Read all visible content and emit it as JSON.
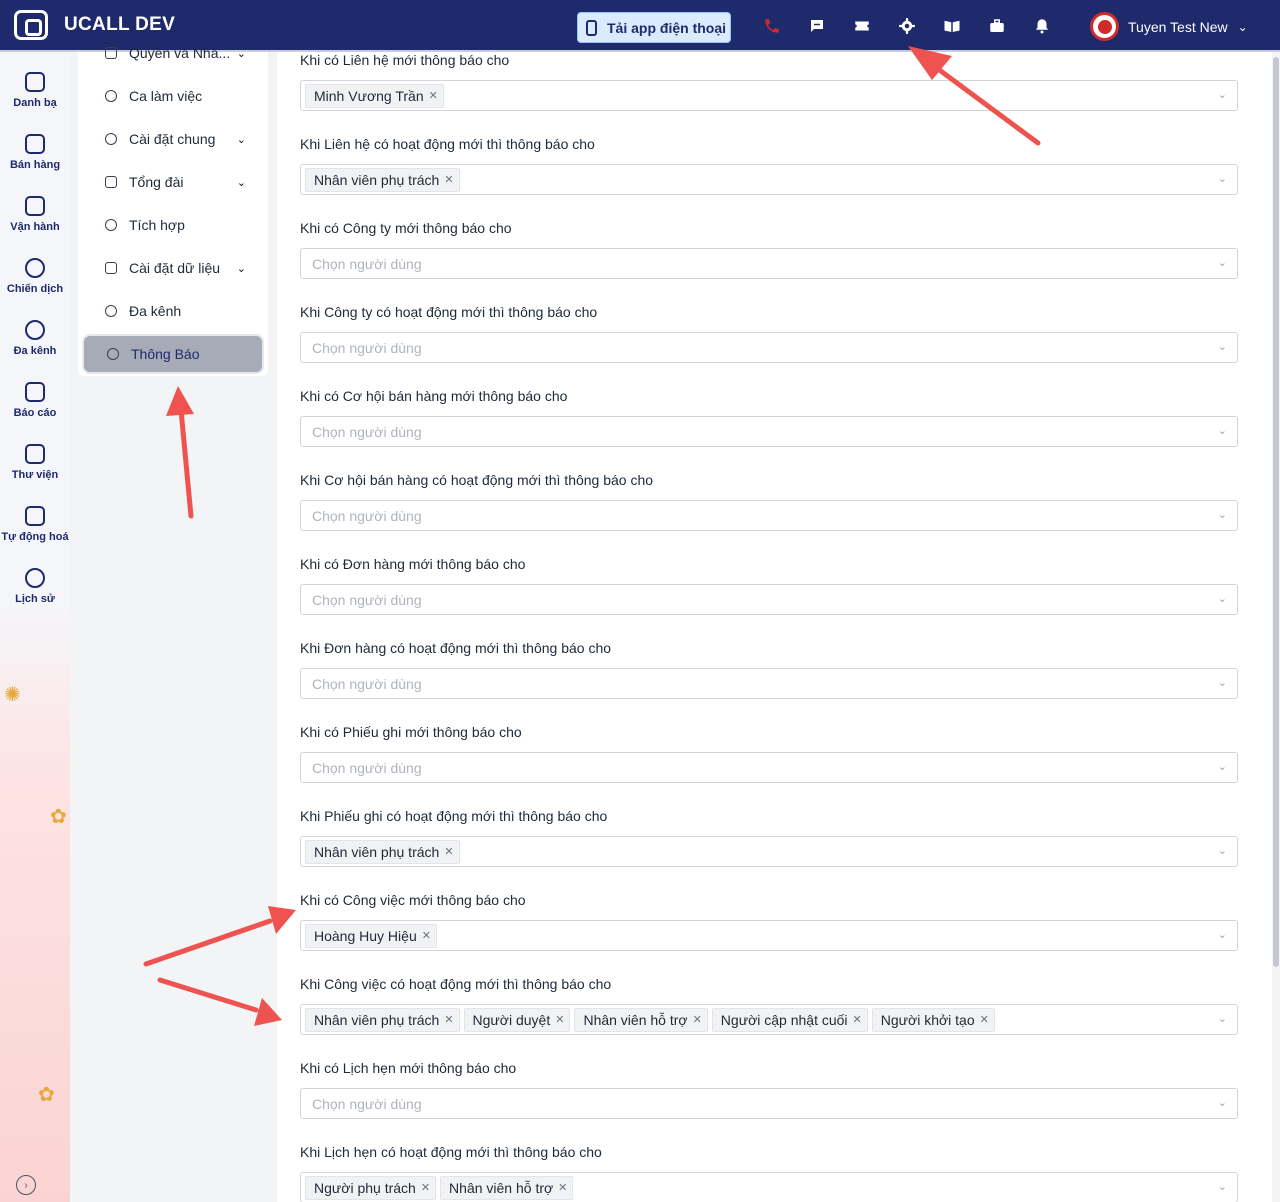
{
  "app": {
    "title": "UCALL DEV"
  },
  "topbar": {
    "download_app_label": "Tải app điện thoại",
    "icons": [
      "phone-icon",
      "chat-icon",
      "ticket-icon",
      "settings-icon",
      "book-icon",
      "briefcase-icon",
      "bell-icon"
    ],
    "user_name": "Tuyen Test New",
    "accent_color": "#1e2a6b",
    "phone_color": "#d12a2a"
  },
  "rail": {
    "items": [
      {
        "label": "Danh bạ",
        "icon": "contacts-icon"
      },
      {
        "label": "Bán hàng",
        "icon": "shop-icon"
      },
      {
        "label": "Vận hành",
        "icon": "briefcase-icon"
      },
      {
        "label": "Chiến dịch",
        "icon": "target-icon"
      },
      {
        "label": "Đa kênh",
        "icon": "headset-icon"
      },
      {
        "label": "Báo cáo",
        "icon": "report-icon"
      },
      {
        "label": "Thư viện",
        "icon": "library-icon"
      },
      {
        "label": "Tự động hoá",
        "icon": "automation-icon"
      },
      {
        "label": "Lịch sử",
        "icon": "history-icon"
      }
    ],
    "expand_glyph": "›"
  },
  "submenu": {
    "items": [
      {
        "label": "Quyền và Nhà...",
        "icon": "users-icon",
        "chevron": "⌄"
      },
      {
        "label": "Ca làm việc",
        "icon": "clock-icon",
        "chevron": ""
      },
      {
        "label": "Cài đặt chung",
        "icon": "gear-icon",
        "chevron": "⌄"
      },
      {
        "label": "Tổng đài",
        "icon": "switchboard-icon",
        "chevron": "⌄"
      },
      {
        "label": "Tích hợp",
        "icon": "integration-icon",
        "chevron": ""
      },
      {
        "label": "Cài đặt dữ liệu",
        "icon": "database-icon",
        "chevron": "⌄"
      },
      {
        "label": "Đa kênh",
        "icon": "chat-icon",
        "chevron": ""
      },
      {
        "label": "Thông Báo",
        "icon": "bell-icon",
        "chevron": "",
        "active": true
      }
    ]
  },
  "settings": {
    "placeholder": "Chọn người dùng",
    "groups": [
      {
        "label": "Khi có Liên hệ mới thông báo cho",
        "tags": [
          "Minh Vương Trần"
        ]
      },
      {
        "label": "Khi Liên hệ có hoạt động mới thì thông báo cho",
        "tags": [
          "Nhân viên phụ trách"
        ]
      },
      {
        "label": "Khi có Công ty mới thông báo cho",
        "tags": []
      },
      {
        "label": "Khi Công ty có hoạt động mới thì thông báo cho",
        "tags": []
      },
      {
        "label": "Khi có Cơ hội bán hàng mới thông báo cho",
        "tags": []
      },
      {
        "label": "Khi Cơ hội bán hàng có hoạt động mới thì thông báo cho",
        "tags": []
      },
      {
        "label": "Khi có Đơn hàng mới thông báo cho",
        "tags": []
      },
      {
        "label": "Khi Đơn hàng có hoạt động mới thì thông báo cho",
        "tags": []
      },
      {
        "label": "Khi có Phiếu ghi mới thông báo cho",
        "tags": []
      },
      {
        "label": "Khi Phiếu ghi có hoạt động mới thì thông báo cho",
        "tags": [
          "Nhân viên phụ trách"
        ]
      },
      {
        "label": "Khi có Công việc mới thông báo cho",
        "tags": [
          "Hoàng Huy Hiệu"
        ]
      },
      {
        "label": "Khi Công việc có hoạt động mới thì thông báo cho",
        "tags": [
          "Nhân viên phụ trách",
          "Người duyệt",
          "Nhân viên hỗ trợ",
          "Người cập nhật cuối",
          "Người khởi tạo"
        ]
      },
      {
        "label": "Khi có Lịch hẹn mới thông báo cho",
        "tags": []
      },
      {
        "label": "Khi Lịch hẹn có hoạt động mới thì thông báo cho",
        "tags": [
          "Người phụ trách",
          "Nhân viên hỗ trợ"
        ]
      }
    ]
  },
  "annotation_color": "#ef5350"
}
